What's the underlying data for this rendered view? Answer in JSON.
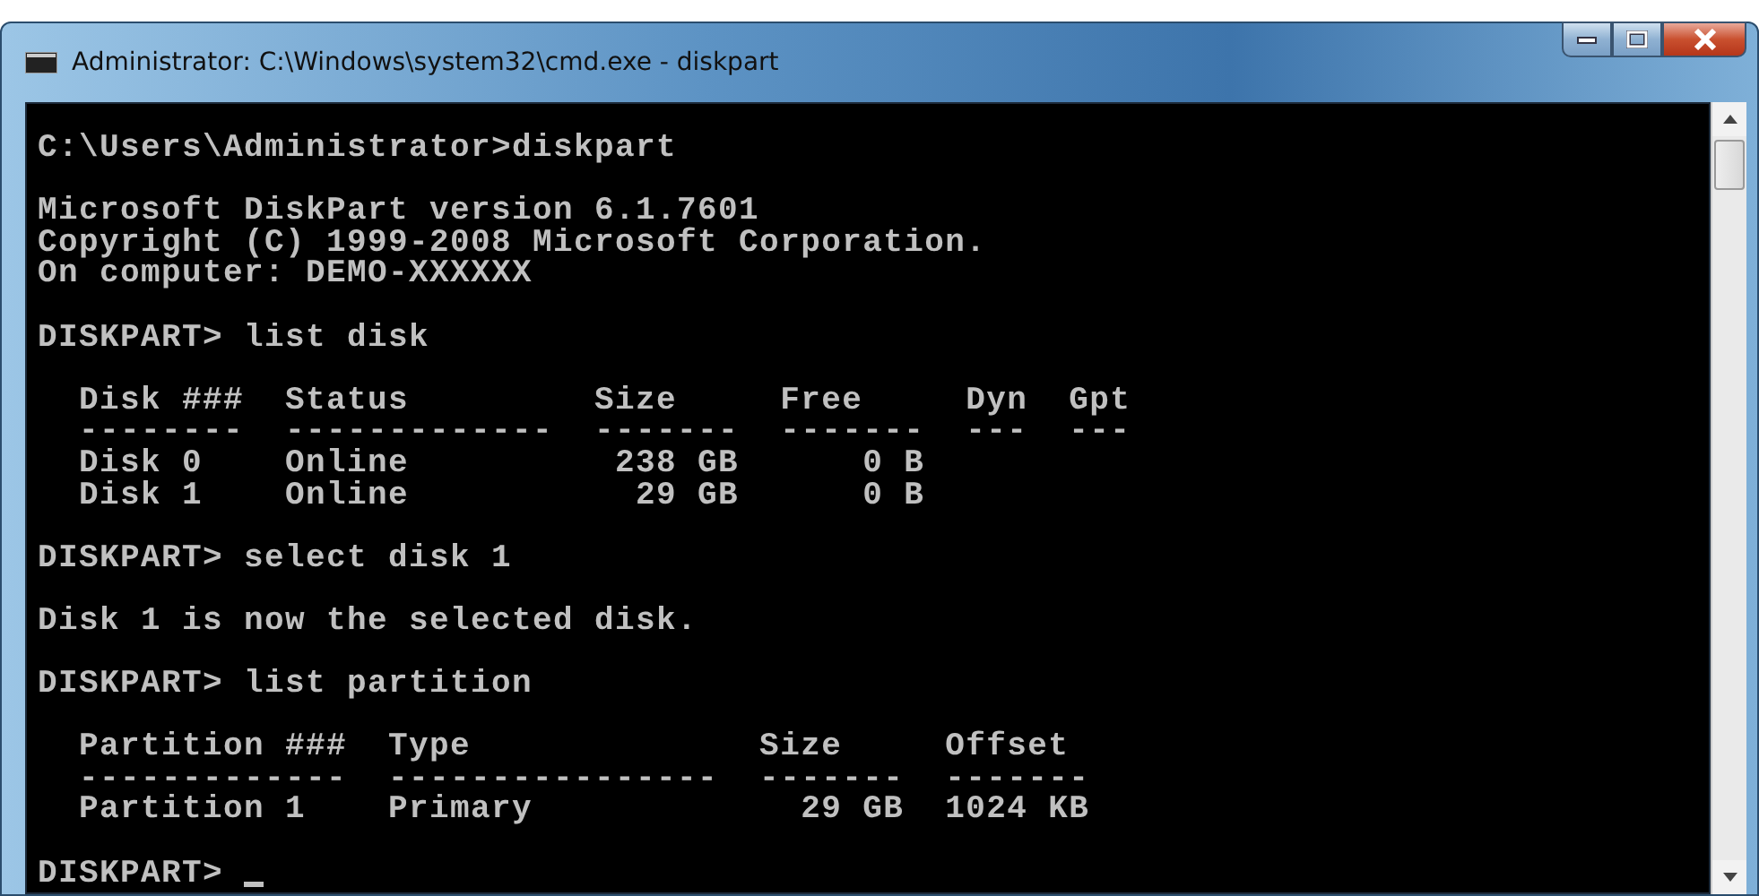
{
  "window": {
    "title": "Administrator: C:\\Windows\\system32\\cmd.exe - diskpart"
  },
  "console": {
    "blocks": [
      [
        "C:\\Users\\Administrator>diskpart"
      ],
      [
        "Microsoft DiskPart version 6.1.7601",
        "Copyright (C) 1999-2008 Microsoft Corporation.",
        "On computer: DEMO-XXXXXX"
      ],
      [
        "DISKPART> list disk"
      ],
      [
        "  Disk ###  Status         Size     Free     Dyn  Gpt",
        "  --------  -------------  -------  -------  ---  ---",
        "  Disk 0    Online          238 GB      0 B",
        "  Disk 1    Online           29 GB      0 B"
      ],
      [
        "DISKPART> select disk 1"
      ],
      [
        "Disk 1 is now the selected disk."
      ],
      [
        "DISKPART> list partition"
      ],
      [
        "  Partition ###  Type              Size     Offset",
        "  -------------  ----------------  -------  -------",
        "  Partition 1    Primary             29 GB  1024 KB"
      ],
      [
        "DISKPART> "
      ]
    ],
    "cursor": true
  }
}
